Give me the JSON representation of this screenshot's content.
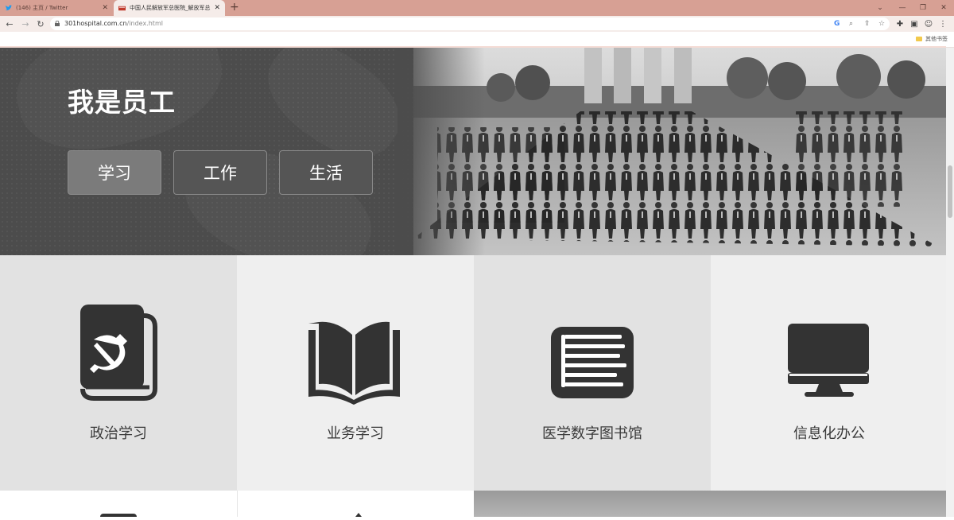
{
  "browser": {
    "tabs": [
      {
        "title": "(146) 主页 / Twitter",
        "active": false
      },
      {
        "title": "中国人民解放军总医院_解放军总",
        "active": true
      }
    ],
    "new_tab_label": "+",
    "url_host": "301hospital.com.cn",
    "url_path": "/index.html",
    "bookmark_folder": "其他书签"
  },
  "hero": {
    "title": "我是员工",
    "buttons": [
      {
        "label": "学习",
        "active": true
      },
      {
        "label": "工作",
        "active": false
      },
      {
        "label": "生活",
        "active": false
      }
    ]
  },
  "tiles": [
    {
      "label": "政治学习",
      "icon": "party-book-icon"
    },
    {
      "label": "业务学习",
      "icon": "open-book-icon"
    },
    {
      "label": "医学数字图书馆",
      "icon": "library-book-icon"
    },
    {
      "label": "信息化办公",
      "icon": "monitor-icon"
    }
  ],
  "colors": {
    "tab_bar": "#d7a094",
    "hero_bg": "#4c4c4c",
    "tile_dark": "#e2e2e2",
    "tile_light": "#efefef",
    "icon": "#333333"
  }
}
